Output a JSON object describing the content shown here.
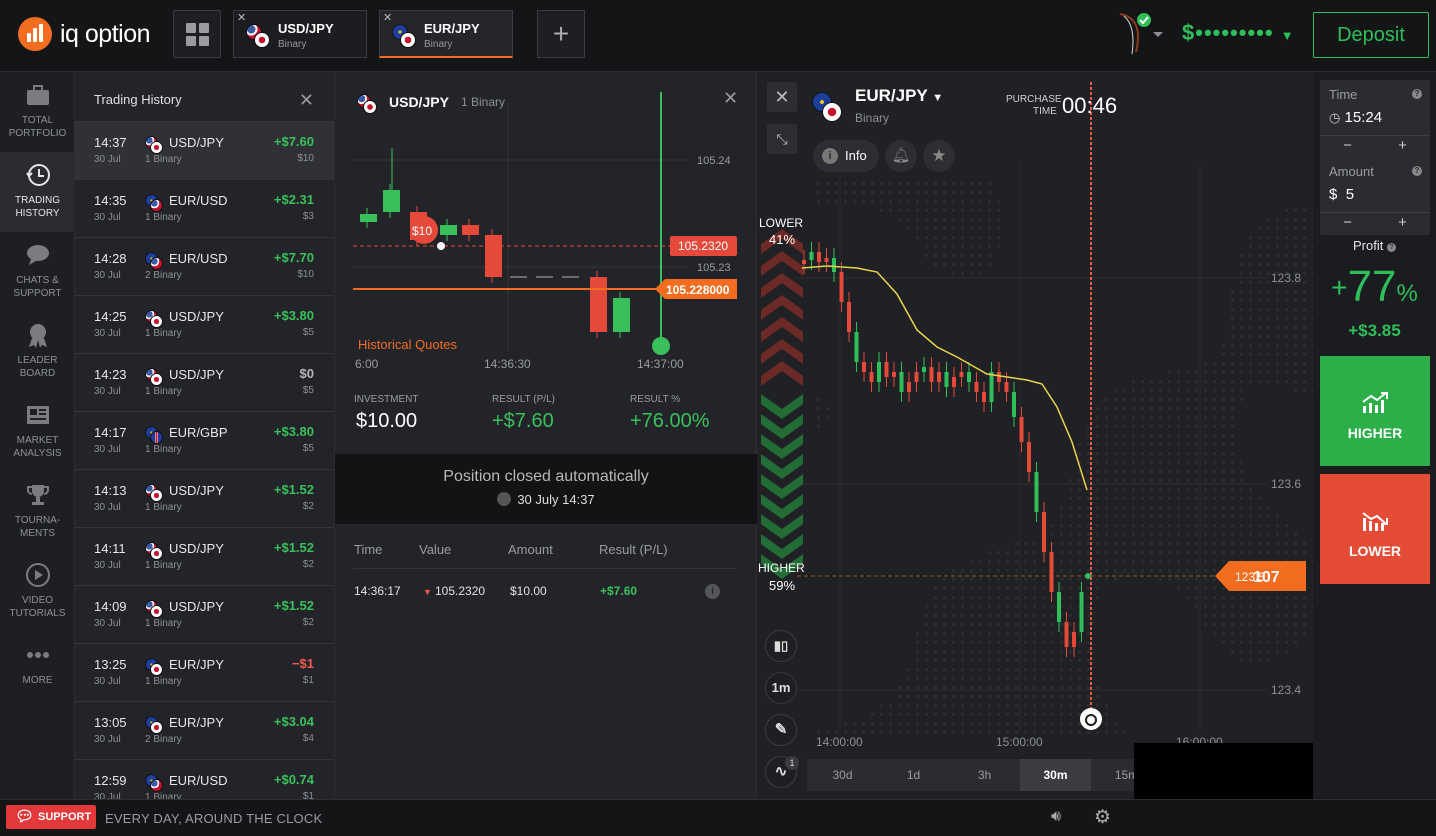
{
  "brand": {
    "name": "iq option",
    "accent": "#f36d21"
  },
  "top_tabs": [
    {
      "name": "USD/JPY",
      "type": "Binary"
    },
    {
      "name": "EUR/JPY",
      "type": "Binary"
    }
  ],
  "account": {
    "balance_masked": "$•••••••••",
    "deposit_label": "Deposit"
  },
  "sidenav": [
    {
      "label1": "TOTAL",
      "label2": "PORTFOLIO"
    },
    {
      "label1": "TRADING",
      "label2": "HISTORY"
    },
    {
      "label1": "CHATS &",
      "label2": "SUPPORT"
    },
    {
      "label1": "LEADER",
      "label2": "BOARD"
    },
    {
      "label1": "MARKET",
      "label2": "ANALYSIS"
    },
    {
      "label1": "TOURNA-",
      "label2": "MENTS"
    },
    {
      "label1": "VIDEO",
      "label2": "TUTORIALS"
    },
    {
      "label1": "MORE",
      "label2": ""
    }
  ],
  "history": {
    "title": "Trading History",
    "rows": [
      {
        "time": "14:37",
        "date": "30 Jul",
        "asset": "USD/JPY",
        "kind": "1 Binary",
        "result": "+$7.60",
        "invest": "$10"
      },
      {
        "time": "14:35",
        "date": "30 Jul",
        "asset": "EUR/USD",
        "kind": "1 Binary",
        "result": "+$2.31",
        "invest": "$3"
      },
      {
        "time": "14:28",
        "date": "30 Jul",
        "asset": "EUR/USD",
        "kind": "2 Binary",
        "result": "+$7.70",
        "invest": "$10"
      },
      {
        "time": "14:25",
        "date": "30 Jul",
        "asset": "USD/JPY",
        "kind": "1 Binary",
        "result": "+$3.80",
        "invest": "$5"
      },
      {
        "time": "14:23",
        "date": "30 Jul",
        "asset": "USD/JPY",
        "kind": "1 Binary",
        "result": "$0",
        "invest": "$5"
      },
      {
        "time": "14:17",
        "date": "30 Jul",
        "asset": "EUR/GBP",
        "kind": "1 Binary",
        "result": "+$3.80",
        "invest": "$5"
      },
      {
        "time": "14:13",
        "date": "30 Jul",
        "asset": "USD/JPY",
        "kind": "1 Binary",
        "result": "+$1.52",
        "invest": "$2"
      },
      {
        "time": "14:11",
        "date": "30 Jul",
        "asset": "USD/JPY",
        "kind": "1 Binary",
        "result": "+$1.52",
        "invest": "$2"
      },
      {
        "time": "14:09",
        "date": "30 Jul",
        "asset": "USD/JPY",
        "kind": "1 Binary",
        "result": "+$1.52",
        "invest": "$2"
      },
      {
        "time": "13:25",
        "date": "30 Jul",
        "asset": "EUR/JPY",
        "kind": "1 Binary",
        "result": "−$1",
        "invest": "$1"
      },
      {
        "time": "13:05",
        "date": "30 Jul",
        "asset": "EUR/JPY",
        "kind": "2 Binary",
        "result": "+$3.04",
        "invest": "$4"
      },
      {
        "time": "12:59",
        "date": "30 Jul",
        "asset": "EUR/USD",
        "kind": "1 Binary",
        "result": "+$0.74",
        "invest": "$1"
      }
    ]
  },
  "detail": {
    "asset": "USD/JPY",
    "type": "1 Binary",
    "chart": {
      "bet_label": "$10",
      "open_price": "105.2320",
      "close_price": "105.228000",
      "levels": [
        "105.24",
        "105.23"
      ],
      "time_labels": [
        "6:00",
        "14:36:30",
        "14:37:00"
      ],
      "caption": "Historical Quotes"
    },
    "investment_label": "INVESTMENT",
    "investment": "$10.00",
    "result_label": "RESULT (P/L)",
    "result": "+$7.60",
    "result_pct_label": "RESULT %",
    "result_pct": "+76.00%",
    "closed_msg": "Position closed automatically",
    "closed_date": "30 July 14:37",
    "table": {
      "headers": [
        "Time",
        "Value",
        "Amount",
        "Result (P/L)"
      ],
      "row": {
        "time": "14:36:17",
        "value": "105.2320",
        "amount": "$10.00",
        "result": "+$7.60"
      }
    }
  },
  "main_chart": {
    "asset": "EUR/JPY",
    "type": "Binary",
    "purchase_label1": "PURCHASE",
    "purchase_label2": "TIME",
    "purchase_time": "00:46",
    "info_label": "Info",
    "lower_label": "LOWER",
    "lower_pct": "41%",
    "higher_label": "HIGHER",
    "higher_pct": "59%",
    "price_levels": [
      "123.8",
      "123.6",
      "123.4"
    ],
    "current_price_small": "123.5",
    "current_price_big": "107",
    "time_labels": [
      "14:00:00",
      "15:00:00",
      "16:00:00"
    ],
    "candle_btn": "1m",
    "indicator_count": "1",
    "timeframes": [
      "30d",
      "1d",
      "3h",
      "30m",
      "15m"
    ],
    "active_timeframe": "30m"
  },
  "trade_panel": {
    "time_label": "Time",
    "time_value": "15:24",
    "amount_label": "Amount",
    "amount_currency": "$",
    "amount_value": "5",
    "profit_label": "Profit",
    "profit_pct": "77",
    "profit_pct_sign": "+",
    "profit_pct_unit": "%",
    "profit_value": "+$3.85",
    "higher_label": "HIGHER",
    "lower_label": "LOWER"
  },
  "footer": {
    "support_label": "SUPPORT",
    "tagline": "EVERY DAY, AROUND THE CLOCK"
  }
}
